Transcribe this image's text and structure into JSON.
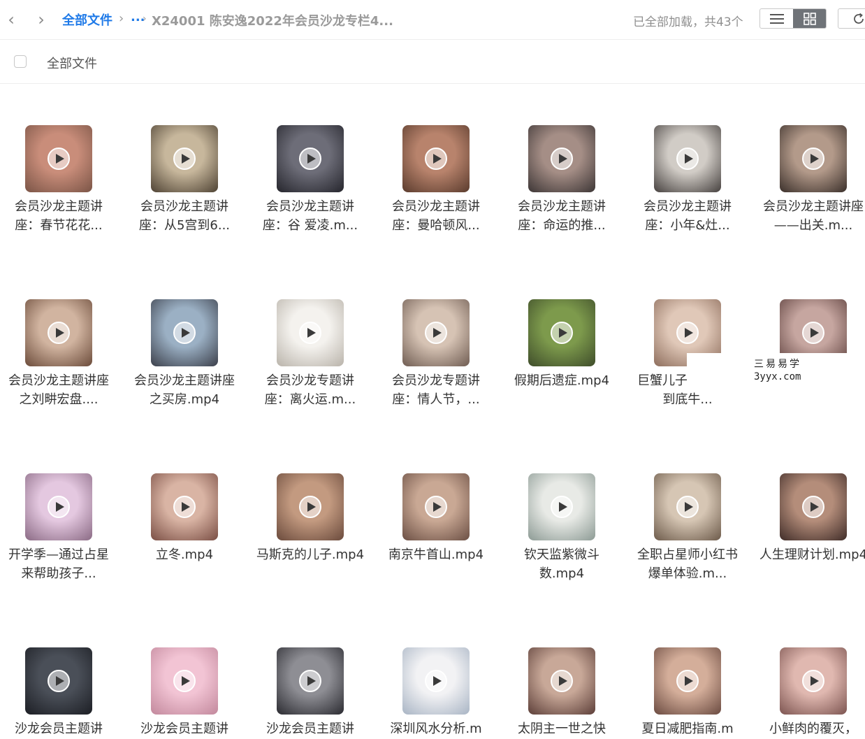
{
  "nav": {
    "back_glyph": "‹",
    "forward_glyph": "›",
    "back_icon": "chevron-left-icon",
    "forward_icon": "chevron-right-icon"
  },
  "breadcrumb": {
    "root": "全部文件",
    "separator": "›",
    "ellipsis": "...",
    "current": "X24001 陈安逸2022年会员沙龙专栏4..."
  },
  "status": "已全部加载，共43个",
  "view_modes": [
    {
      "name": "list",
      "icon": "list-icon",
      "active": false
    },
    {
      "name": "grid",
      "icon": "grid-icon",
      "active": true
    }
  ],
  "refresh_icon": "refresh-icon",
  "select_all_label": "全部文件",
  "play_icon": "play-icon",
  "files": [
    {
      "name": "会员沙龙主题讲座：春节花花...",
      "thumb": [
        "#c98d7a",
        "#7a5446"
      ]
    },
    {
      "name": "会员沙龙主题讲座：从5宫到6...",
      "thumb": [
        "#c7b79c",
        "#4e4233"
      ]
    },
    {
      "name": "会员沙龙主题讲座：谷 爱凌.m...",
      "thumb": [
        "#6d6d78",
        "#25252c"
      ]
    },
    {
      "name": "会员沙龙主题讲座：曼哈顿风...",
      "thumb": [
        "#b8836c",
        "#5a3b2d"
      ]
    },
    {
      "name": "会员沙龙主题讲座：命运的推...",
      "thumb": [
        "#a58e86",
        "#3c3535"
      ]
    },
    {
      "name": "会员沙龙主题讲座：小年&灶...",
      "thumb": [
        "#d1ccc6",
        "#45403e"
      ]
    },
    {
      "name": "会员沙龙主题讲座——出关.m...",
      "thumb": [
        "#b39a8a",
        "#3a2f2a"
      ]
    },
    {
      "name": "会员沙龙主题讲座之刘畊宏盘....",
      "thumb": [
        "#d1b4a0",
        "#6b4b3a"
      ]
    },
    {
      "name": "会员沙龙主题讲座之买房.mp4",
      "thumb": [
        "#9bb0c4",
        "#3b3f4a"
      ]
    },
    {
      "name": "会员沙龙专题讲座：离火运.m...",
      "thumb": [
        "#f4f2ee",
        "#b9b3aa"
      ]
    },
    {
      "name": "会员沙龙专题讲座：情人节，...",
      "thumb": [
        "#d6c3b4",
        "#6f5c52"
      ]
    },
    {
      "name": "假期后遗症.mp4",
      "thumb": [
        "#7d9a4c",
        "#3e4c2a"
      ]
    },
    {
      "name": "巨蟹儿子——张兰到底牛...",
      "thumb": [
        "#e0c8b8",
        "#8d6d5c"
      ]
    },
    {
      "name": "",
      "thumb": [
        "#c6a6a0",
        "#5c3f3c"
      ]
    },
    {
      "name": "开学季—通过占星来帮助孩子...",
      "thumb": [
        "#e4c8e0",
        "#8a6a84"
      ]
    },
    {
      "name": "立冬.mp4",
      "thumb": [
        "#d9b4a4",
        "#7a4e44"
      ]
    },
    {
      "name": "马斯克的儿子.mp4",
      "thumb": [
        "#c39a80",
        "#6a4a3c"
      ]
    },
    {
      "name": "南京牛首山.mp4",
      "thumb": [
        "#c9a894",
        "#6b4f44"
      ]
    },
    {
      "name": "钦天监紫微斗数.mp4",
      "thumb": [
        "#e8eae6",
        "#8c9a94"
      ]
    },
    {
      "name": "全职占星师小红书爆单体验.m...",
      "thumb": [
        "#d6c6b4",
        "#6c5a4a"
      ]
    },
    {
      "name": "人生理财计划.mp4",
      "thumb": [
        "#b48d7a",
        "#3f2c28"
      ]
    },
    {
      "name": "沙龙会员主题讲",
      "thumb": [
        "#4a4f58",
        "#1c1e24"
      ]
    },
    {
      "name": "沙龙会员主题讲",
      "thumb": [
        "#f2c4d4",
        "#c2889c"
      ]
    },
    {
      "name": "沙龙会员主题讲",
      "thumb": [
        "#8e8e94",
        "#2a2a30"
      ]
    },
    {
      "name": "深圳风水分析.m",
      "thumb": [
        "#f2f2f4",
        "#a8b4c4"
      ]
    },
    {
      "name": "太阴主一世之快",
      "thumb": [
        "#c8a898",
        "#5c3e38"
      ]
    },
    {
      "name": "夏日减肥指南.m",
      "thumb": [
        "#d4ae9a",
        "#6a4a40"
      ]
    },
    {
      "name": "小鲜肉的覆灭，",
      "thumb": [
        "#e0b8b0",
        "#7c5450"
      ]
    }
  ],
  "watermark": {
    "line1": "三易易学",
    "line2": "3yyx.com"
  }
}
